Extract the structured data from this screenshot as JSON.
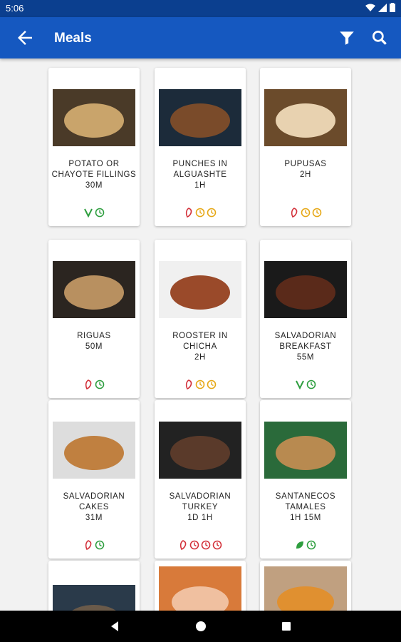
{
  "status": {
    "time": "5:06"
  },
  "appbar": {
    "title": "Meals"
  },
  "meals": [
    {
      "name": "POTATO OR CHAYOTE FILLINGS",
      "time": "30M",
      "badges": [
        "vegan",
        "time-green"
      ]
    },
    {
      "name": "PUNCHES IN ALGUASHTE",
      "time": "1H",
      "badges": [
        "pepper",
        "time-yellow",
        "time-yellow"
      ]
    },
    {
      "name": "PUPUSAS",
      "time": "2H",
      "badges": [
        "pepper",
        "time-yellow",
        "time-yellow"
      ]
    },
    {
      "name": "RIGUAS",
      "time": "50M",
      "badges": [
        "pepper",
        "time-green"
      ]
    },
    {
      "name": "ROOSTER IN CHICHA",
      "time": "2H",
      "badges": [
        "pepper",
        "time-yellow",
        "time-yellow"
      ]
    },
    {
      "name": "SALVADORIAN BREAKFAST",
      "time": "55M",
      "badges": [
        "vegan",
        "time-green"
      ]
    },
    {
      "name": "SALVADORIAN CAKES",
      "time": "31M",
      "badges": [
        "pepper",
        "time-green"
      ]
    },
    {
      "name": "SALVADORIAN TURKEY",
      "time": "1D 1H",
      "badges": [
        "pepper",
        "time-red",
        "time-red",
        "time-red"
      ]
    },
    {
      "name": "SANTANECOS TAMALES",
      "time": "1H 15M",
      "badges": [
        "leaf",
        "time-green"
      ]
    }
  ],
  "colors": {
    "appbar": "#1558c0",
    "statusbar": "#0b3f8f",
    "green": "#2e9e3f",
    "yellow": "#e6a817",
    "red": "#d3323b"
  }
}
